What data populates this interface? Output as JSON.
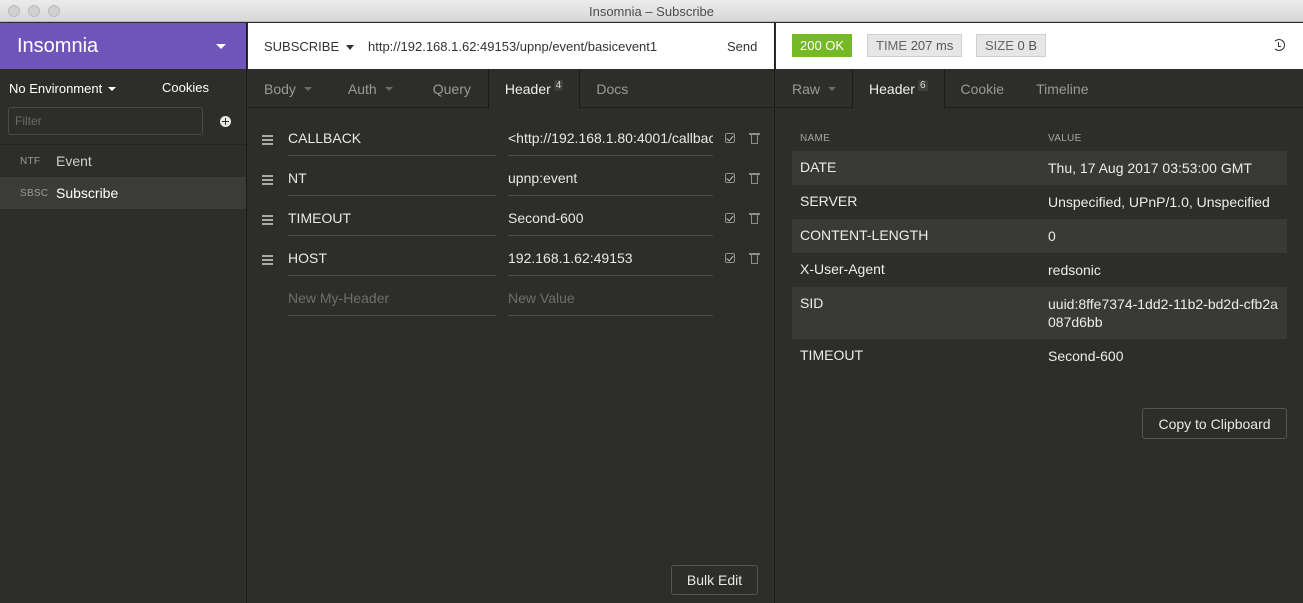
{
  "window": {
    "title": "Insomnia – Subscribe"
  },
  "sidebar": {
    "brand": "Insomnia",
    "environment": "No Environment",
    "cookies": "Cookies",
    "filter_placeholder": "Filter",
    "requests": [
      {
        "method": "NTF",
        "name": "Event",
        "active": false
      },
      {
        "method": "SBSC",
        "name": "Subscribe",
        "active": true
      }
    ]
  },
  "request": {
    "method": "SUBSCRIBE",
    "url": "http://192.168.1.62:49153/upnp/event/basicevent1",
    "send_label": "Send",
    "tabs": [
      {
        "label": "Body",
        "dropdown": true
      },
      {
        "label": "Auth",
        "dropdown": true
      },
      {
        "label": "Query"
      },
      {
        "label": "Header",
        "badge": "4",
        "active": true
      },
      {
        "label": "Docs"
      }
    ],
    "headers": [
      {
        "name": "CALLBACK",
        "value": "<http://192.168.1.80:4001/callbac"
      },
      {
        "name": "NT",
        "value": "upnp:event"
      },
      {
        "name": "TIMEOUT",
        "value": "Second-600"
      },
      {
        "name": "HOST",
        "value": "192.168.1.62:49153"
      }
    ],
    "new_name_placeholder": "New My-Header",
    "new_value_placeholder": "New Value",
    "bulk_edit_label": "Bulk Edit"
  },
  "response": {
    "status": "200 OK",
    "time_label": "TIME",
    "time_value": "207 ms",
    "size_label": "SIZE",
    "size_value": "0 B",
    "status_color": "#75ba24",
    "tabs": [
      {
        "label": "Raw",
        "dropdown": true
      },
      {
        "label": "Header",
        "badge": "6",
        "active": true
      },
      {
        "label": "Cookie"
      },
      {
        "label": "Timeline"
      }
    ],
    "columns": {
      "name": "NAME",
      "value": "VALUE"
    },
    "headers": [
      {
        "name": "DATE",
        "value": "Thu, 17 Aug 2017 03:53:00 GMT"
      },
      {
        "name": "SERVER",
        "value": "Unspecified, UPnP/1.0, Unspecified"
      },
      {
        "name": "CONTENT-LENGTH",
        "value": "0"
      },
      {
        "name": "X-User-Agent",
        "value": "redsonic"
      },
      {
        "name": "SID",
        "value": "uuid:8ffe7374-1dd2-11b2-bd2d-cfb2a087d6bb"
      },
      {
        "name": "TIMEOUT",
        "value": "Second-600"
      }
    ],
    "copy_label": "Copy to Clipboard"
  },
  "colors": {
    "brand": "#6f55b9",
    "background": "#2d2d2a",
    "ok": "#75ba24"
  }
}
